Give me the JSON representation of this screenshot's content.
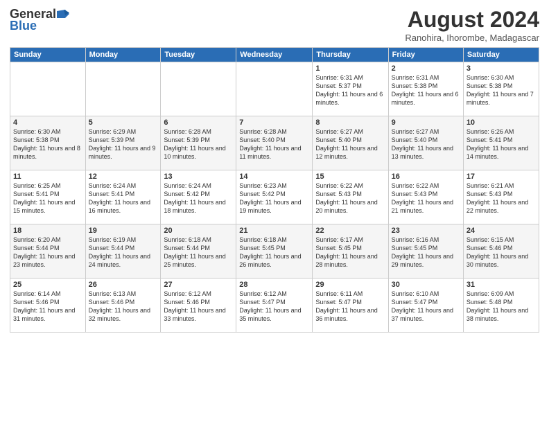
{
  "header": {
    "logo_general": "General",
    "logo_blue": "Blue",
    "month_year": "August 2024",
    "location": "Ranohira, Ihorombe, Madagascar"
  },
  "days_of_week": [
    "Sunday",
    "Monday",
    "Tuesday",
    "Wednesday",
    "Thursday",
    "Friday",
    "Saturday"
  ],
  "weeks": [
    [
      {
        "day": "",
        "info": ""
      },
      {
        "day": "",
        "info": ""
      },
      {
        "day": "",
        "info": ""
      },
      {
        "day": "",
        "info": ""
      },
      {
        "day": "1",
        "info": "Sunrise: 6:31 AM\nSunset: 5:37 PM\nDaylight: 11 hours and 6 minutes."
      },
      {
        "day": "2",
        "info": "Sunrise: 6:31 AM\nSunset: 5:38 PM\nDaylight: 11 hours and 6 minutes."
      },
      {
        "day": "3",
        "info": "Sunrise: 6:30 AM\nSunset: 5:38 PM\nDaylight: 11 hours and 7 minutes."
      }
    ],
    [
      {
        "day": "4",
        "info": "Sunrise: 6:30 AM\nSunset: 5:38 PM\nDaylight: 11 hours and 8 minutes."
      },
      {
        "day": "5",
        "info": "Sunrise: 6:29 AM\nSunset: 5:39 PM\nDaylight: 11 hours and 9 minutes."
      },
      {
        "day": "6",
        "info": "Sunrise: 6:28 AM\nSunset: 5:39 PM\nDaylight: 11 hours and 10 minutes."
      },
      {
        "day": "7",
        "info": "Sunrise: 6:28 AM\nSunset: 5:40 PM\nDaylight: 11 hours and 11 minutes."
      },
      {
        "day": "8",
        "info": "Sunrise: 6:27 AM\nSunset: 5:40 PM\nDaylight: 11 hours and 12 minutes."
      },
      {
        "day": "9",
        "info": "Sunrise: 6:27 AM\nSunset: 5:40 PM\nDaylight: 11 hours and 13 minutes."
      },
      {
        "day": "10",
        "info": "Sunrise: 6:26 AM\nSunset: 5:41 PM\nDaylight: 11 hours and 14 minutes."
      }
    ],
    [
      {
        "day": "11",
        "info": "Sunrise: 6:25 AM\nSunset: 5:41 PM\nDaylight: 11 hours and 15 minutes."
      },
      {
        "day": "12",
        "info": "Sunrise: 6:24 AM\nSunset: 5:41 PM\nDaylight: 11 hours and 16 minutes."
      },
      {
        "day": "13",
        "info": "Sunrise: 6:24 AM\nSunset: 5:42 PM\nDaylight: 11 hours and 18 minutes."
      },
      {
        "day": "14",
        "info": "Sunrise: 6:23 AM\nSunset: 5:42 PM\nDaylight: 11 hours and 19 minutes."
      },
      {
        "day": "15",
        "info": "Sunrise: 6:22 AM\nSunset: 5:43 PM\nDaylight: 11 hours and 20 minutes."
      },
      {
        "day": "16",
        "info": "Sunrise: 6:22 AM\nSunset: 5:43 PM\nDaylight: 11 hours and 21 minutes."
      },
      {
        "day": "17",
        "info": "Sunrise: 6:21 AM\nSunset: 5:43 PM\nDaylight: 11 hours and 22 minutes."
      }
    ],
    [
      {
        "day": "18",
        "info": "Sunrise: 6:20 AM\nSunset: 5:44 PM\nDaylight: 11 hours and 23 minutes."
      },
      {
        "day": "19",
        "info": "Sunrise: 6:19 AM\nSunset: 5:44 PM\nDaylight: 11 hours and 24 minutes."
      },
      {
        "day": "20",
        "info": "Sunrise: 6:18 AM\nSunset: 5:44 PM\nDaylight: 11 hours and 25 minutes."
      },
      {
        "day": "21",
        "info": "Sunrise: 6:18 AM\nSunset: 5:45 PM\nDaylight: 11 hours and 26 minutes."
      },
      {
        "day": "22",
        "info": "Sunrise: 6:17 AM\nSunset: 5:45 PM\nDaylight: 11 hours and 28 minutes."
      },
      {
        "day": "23",
        "info": "Sunrise: 6:16 AM\nSunset: 5:45 PM\nDaylight: 11 hours and 29 minutes."
      },
      {
        "day": "24",
        "info": "Sunrise: 6:15 AM\nSunset: 5:46 PM\nDaylight: 11 hours and 30 minutes."
      }
    ],
    [
      {
        "day": "25",
        "info": "Sunrise: 6:14 AM\nSunset: 5:46 PM\nDaylight: 11 hours and 31 minutes."
      },
      {
        "day": "26",
        "info": "Sunrise: 6:13 AM\nSunset: 5:46 PM\nDaylight: 11 hours and 32 minutes."
      },
      {
        "day": "27",
        "info": "Sunrise: 6:12 AM\nSunset: 5:46 PM\nDaylight: 11 hours and 33 minutes."
      },
      {
        "day": "28",
        "info": "Sunrise: 6:12 AM\nSunset: 5:47 PM\nDaylight: 11 hours and 35 minutes."
      },
      {
        "day": "29",
        "info": "Sunrise: 6:11 AM\nSunset: 5:47 PM\nDaylight: 11 hours and 36 minutes."
      },
      {
        "day": "30",
        "info": "Sunrise: 6:10 AM\nSunset: 5:47 PM\nDaylight: 11 hours and 37 minutes."
      },
      {
        "day": "31",
        "info": "Sunrise: 6:09 AM\nSunset: 5:48 PM\nDaylight: 11 hours and 38 minutes."
      }
    ]
  ]
}
